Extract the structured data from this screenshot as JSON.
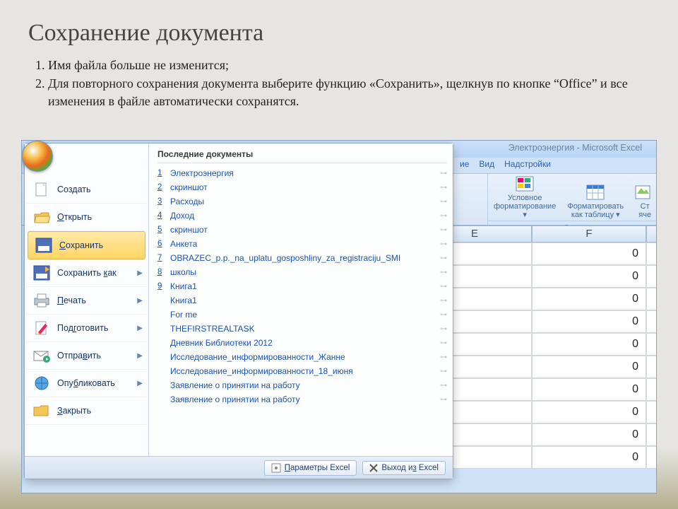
{
  "slide": {
    "title": "Сохранение документа",
    "bullets": [
      "Имя файла больше не изменится;",
      "Для повторного сохранения документа выберите функцию «Сохранить», щелкнув по кнопке “Office”  и  все изменения в файле автоматически сохранятся."
    ]
  },
  "window_title": "Электроэнергия - Microsoft Excel",
  "ribbon_tabs": {
    "a": "ие",
    "b": "Вид",
    "c": "Надстройки"
  },
  "ribbon": {
    "cond_fmt_l1": "Условное",
    "cond_fmt_l2": "форматирование ▾",
    "fmt_table_l1": "Форматировать",
    "fmt_table_l2": "как таблицу ▾",
    "cell_styles_l1": "Ст",
    "cell_styles_l2": "яче",
    "group_caption": "Стили"
  },
  "grid": {
    "cols": [
      "E",
      "F"
    ],
    "values": [
      "0",
      "0",
      "0",
      "0",
      "0",
      "0",
      "0",
      "0",
      "0",
      "0"
    ]
  },
  "menu": {
    "items": {
      "create": "Создать",
      "open": "Открыть",
      "save": "Сохранить",
      "save_as": "Сохранить как",
      "print": "Печать",
      "prepare": "Подготовить",
      "send": "Отправить",
      "publish": "Опубликовать",
      "close": "Закрыть"
    },
    "recent_title": "Последние документы",
    "recent": [
      {
        "n": "1",
        "name": "Электроэнергия"
      },
      {
        "n": "2",
        "name": "скриншот"
      },
      {
        "n": "3",
        "name": "Расходы"
      },
      {
        "n": "4",
        "name": "Доход"
      },
      {
        "n": "5",
        "name": "скриншот"
      },
      {
        "n": "6",
        "name": "Анкета"
      },
      {
        "n": "7",
        "name": "OBRAZEC_p.p._na_uplatu_gosposhliny_za_registraciju_SMI"
      },
      {
        "n": "8",
        "name": "школы"
      },
      {
        "n": "9",
        "name": "Книга1"
      },
      {
        "n": "",
        "name": "Книга1"
      },
      {
        "n": "",
        "name": "For me"
      },
      {
        "n": "",
        "name": "THEFIRSTREALTASK"
      },
      {
        "n": "",
        "name": "Дневник Библиотеки 2012"
      },
      {
        "n": "",
        "name": "Исследование_информированности_Жанне"
      },
      {
        "n": "",
        "name": "Исследование_информированности_18_июня"
      },
      {
        "n": "",
        "name": "Заявление о принятии на работу"
      },
      {
        "n": "",
        "name": "Заявление о принятии на работу"
      }
    ],
    "footer": {
      "options": "Параметры Excel",
      "exit": "Выход из Excel"
    }
  }
}
